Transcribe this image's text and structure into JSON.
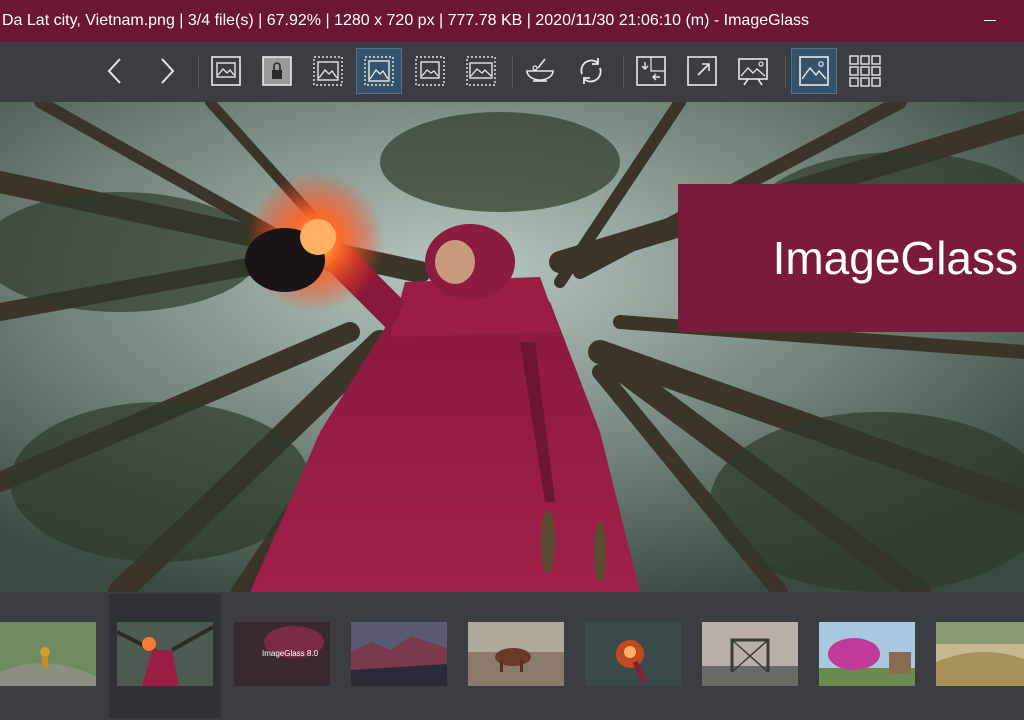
{
  "window": {
    "title": "Da Lat city, Vietnam.png  |  3/4 file(s)  |  67.92%  |  1280 x 720 px  |  777.78 KB  |  2020/11/30 21:06:10 (m)  - ImageGlass"
  },
  "toolbar": {
    "buttons": [
      {
        "name": "previous-image-button",
        "icon": "chevron-left-icon"
      },
      {
        "name": "next-image-button",
        "icon": "chevron-right-icon"
      },
      {
        "name": "auto-zoom-button",
        "icon": "image-frame-icon"
      },
      {
        "name": "lock-zoom-button",
        "icon": "lock-image-icon"
      },
      {
        "name": "scale-to-width-button",
        "icon": "scale-width-icon"
      },
      {
        "name": "scale-to-fit-button",
        "icon": "scale-fit-icon",
        "active": true
      },
      {
        "name": "scale-to-height-button",
        "icon": "scale-height-icon"
      },
      {
        "name": "scale-to-fill-button",
        "icon": "scale-fill-icon"
      },
      {
        "name": "open-with-button",
        "icon": "bowl-icon"
      },
      {
        "name": "refresh-button",
        "icon": "refresh-icon"
      },
      {
        "name": "goto-image-button",
        "icon": "goto-icon"
      },
      {
        "name": "fullscreen-button",
        "icon": "expand-icon"
      },
      {
        "name": "slideshow-button",
        "icon": "slideshow-icon"
      },
      {
        "name": "thumbnail-bar-button",
        "icon": "thumbnail-icon",
        "active": true
      },
      {
        "name": "grid-view-button",
        "icon": "grid-icon"
      }
    ]
  },
  "viewer": {
    "banner_text": "ImageGlass"
  },
  "thumbnails": {
    "selected_index": 1,
    "items": [
      {
        "name": "thumb-child-bicycle"
      },
      {
        "name": "thumb-red-lantern"
      },
      {
        "name": "thumb-imageglass-logo",
        "text": "ImageGlass 8.0"
      },
      {
        "name": "thumb-mountains"
      },
      {
        "name": "thumb-cow"
      },
      {
        "name": "thumb-lantern-closeup"
      },
      {
        "name": "thumb-bridge"
      },
      {
        "name": "thumb-pink-flowers"
      },
      {
        "name": "thumb-grass-field"
      }
    ]
  },
  "colors": {
    "titlebar": "#6a1634",
    "toolbar": "#3b3d42",
    "accent": "#7a1a3c",
    "active_button": "#34526a"
  }
}
